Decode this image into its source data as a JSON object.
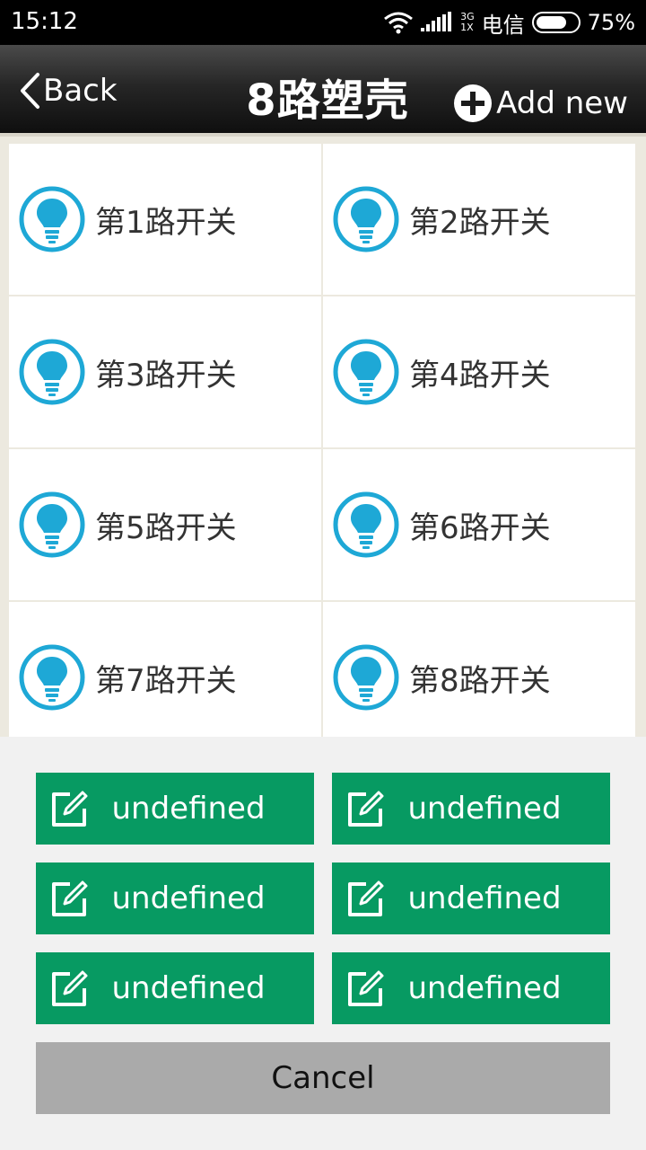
{
  "status_bar": {
    "time": "15:12",
    "network_top": "3G",
    "network_bottom": "1X",
    "carrier": "电信",
    "battery": "75%",
    "battery_level": 0.75,
    "icons": [
      "wifi-icon",
      "signal-icon",
      "battery-icon"
    ]
  },
  "header": {
    "back_label": "Back",
    "title": "8路塑壳",
    "add_label": "Add new"
  },
  "switches": [
    {
      "label": "第1路开关",
      "icon": "bulb-icon"
    },
    {
      "label": "第2路开关",
      "icon": "bulb-icon"
    },
    {
      "label": "第3路开关",
      "icon": "bulb-icon"
    },
    {
      "label": "第4路开关",
      "icon": "bulb-icon"
    },
    {
      "label": "第5路开关",
      "icon": "bulb-icon"
    },
    {
      "label": "第6路开关",
      "icon": "bulb-icon"
    },
    {
      "label": "第7路开关",
      "icon": "bulb-icon"
    },
    {
      "label": "第8路开关",
      "icon": "bulb-icon"
    }
  ],
  "sheet": {
    "actions": [
      {
        "label": "undefined",
        "icon": "edit-icon"
      },
      {
        "label": "undefined",
        "icon": "edit-icon"
      },
      {
        "label": "undefined",
        "icon": "edit-icon"
      },
      {
        "label": "undefined",
        "icon": "edit-icon"
      },
      {
        "label": "undefined",
        "icon": "edit-icon"
      },
      {
        "label": "undefined",
        "icon": "edit-icon"
      }
    ],
    "cancel_label": "Cancel"
  },
  "colors": {
    "accent_green": "#079a62",
    "bulb_blue": "#1ea8d6",
    "cancel_gray": "#aaaaaa"
  }
}
